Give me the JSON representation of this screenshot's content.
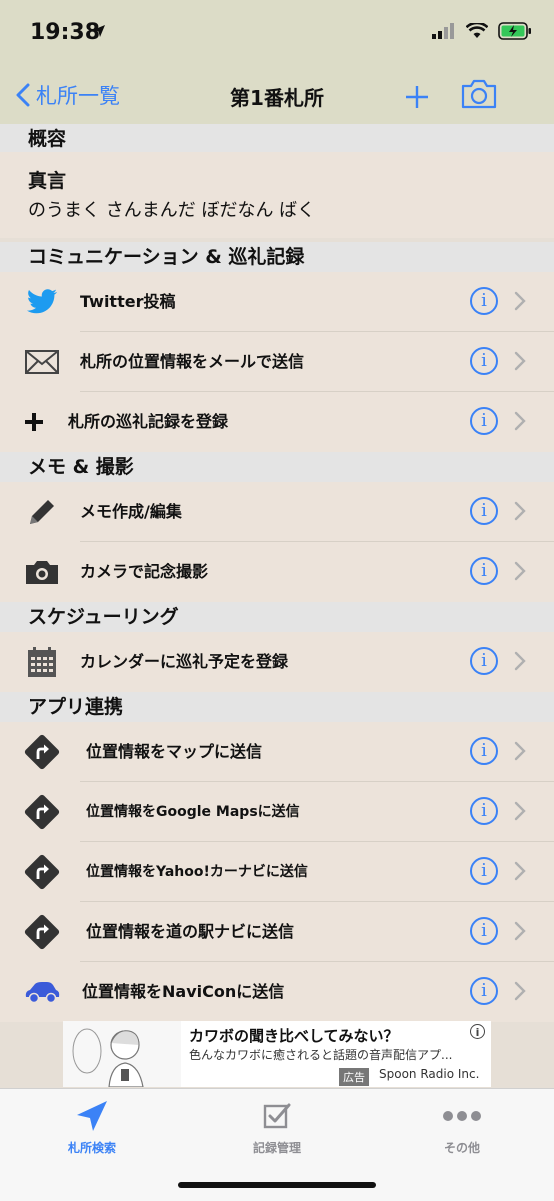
{
  "status": {
    "time": "19:38"
  },
  "nav": {
    "back_label": "札所一覧",
    "title": "第1番札所"
  },
  "sections": {
    "overview": "概容",
    "comm": "コミュニケーション & 巡礼記録",
    "memo": "メモ & 撮影",
    "schedule": "スケジューリング",
    "apps": "アプリ連携"
  },
  "shingon": {
    "label": "真言",
    "text": "のうまく さんまんだ ぼだなん ばく"
  },
  "rows": {
    "twitter": "Twitter投稿",
    "mail": "札所の位置情報をメールで送信",
    "record": "札所の巡礼記録を登録",
    "memo": "メモ作成/編集",
    "camera": "カメラで記念撮影",
    "calendar": "カレンダーに巡礼予定を登録",
    "map": "位置情報をマップに送信",
    "google": "位置情報をGoogle Mapsに送信",
    "yahoo": "位置情報をYahoo!カーナビに送信",
    "michi": "位置情報を道の駅ナビに送信",
    "navicon": "位置情報をNaviConに送信"
  },
  "info_glyph": "i",
  "ad": {
    "title": "カワボの聞き比べしてみない？",
    "subtitle": "色んなカワボに癒されると話題の音声配信アプ...",
    "badge": "広告",
    "sponsor": "Spoon Radio Inc.",
    "info": "i"
  },
  "tabs": {
    "tab1": "札所検索",
    "tab2": "記録管理",
    "tab3": "その他"
  },
  "colors": {
    "accent": "#3b82f6",
    "bar": "#dcdcc7",
    "row": "#ece3da",
    "header": "#e4e4e4"
  }
}
